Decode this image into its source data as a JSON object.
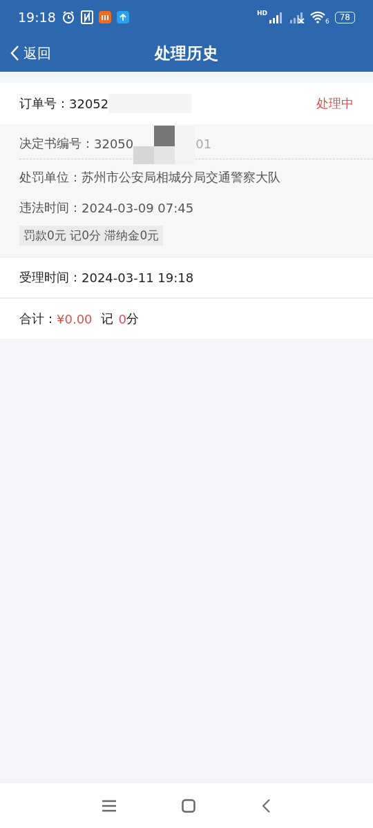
{
  "status_bar": {
    "time": "19:18",
    "network_label": "HD",
    "wifi_label": "6",
    "battery": "78"
  },
  "header": {
    "back_label": "返回",
    "title": "处理历史"
  },
  "order": {
    "label": "订单号：",
    "number": "32052",
    "status": "处理中"
  },
  "details": {
    "decision_label": "决定书编号：",
    "decision_start": "32050",
    "decision_end": "01",
    "rows": [
      {
        "label": "处罚单位：",
        "value": "苏州市公安局相城分局交通警察大队"
      },
      {
        "label": "违法时间：",
        "value": "2024-03-09 07:45"
      }
    ],
    "penalty": "罚款0元 记0分 滞纳金0元"
  },
  "accept": {
    "label": "受理时间：",
    "value": "2024-03-11 19:18"
  },
  "total": {
    "label": "合计：",
    "amount": "¥0.00",
    "points_label": "记",
    "points": "0",
    "points_unit": "分"
  }
}
